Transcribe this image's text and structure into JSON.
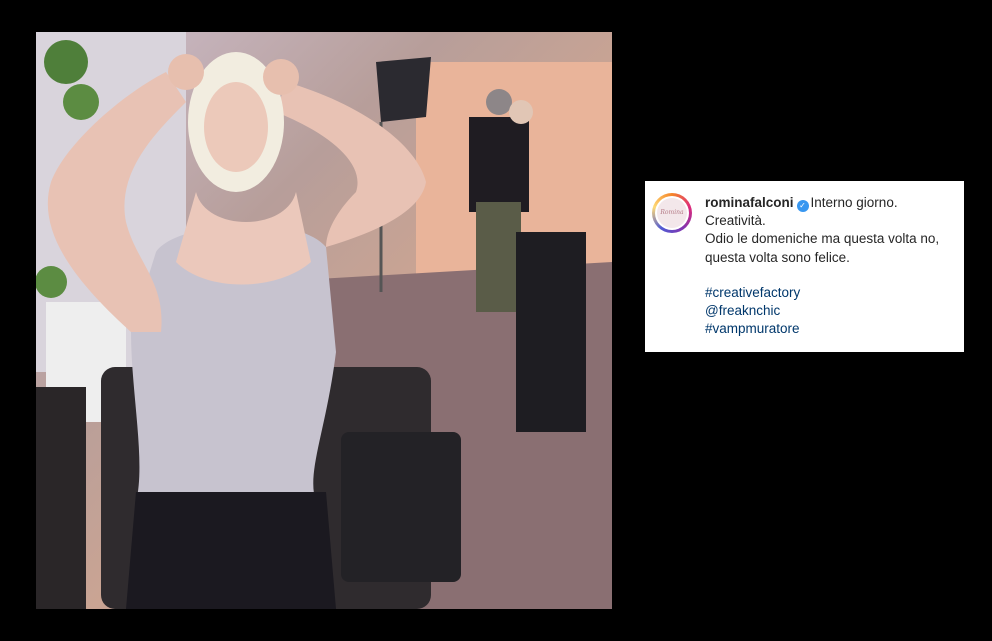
{
  "post": {
    "username": "rominafalconi",
    "caption_lines": [
      "Interno giorno.",
      "Creatività.",
      "Odio le domeniche ma questa volta no,",
      "questa volta sono felice."
    ],
    "hashtags": [
      "#creativefactory",
      "@freaknchic",
      "#vampmuratore"
    ],
    "avatar_text": "Romina"
  },
  "colors": {
    "background": "#000000",
    "verified_badge": "#3897f0",
    "hashtag": "#00376b",
    "text": "#262626"
  },
  "icons": {
    "verified": "verified-badge-icon"
  }
}
